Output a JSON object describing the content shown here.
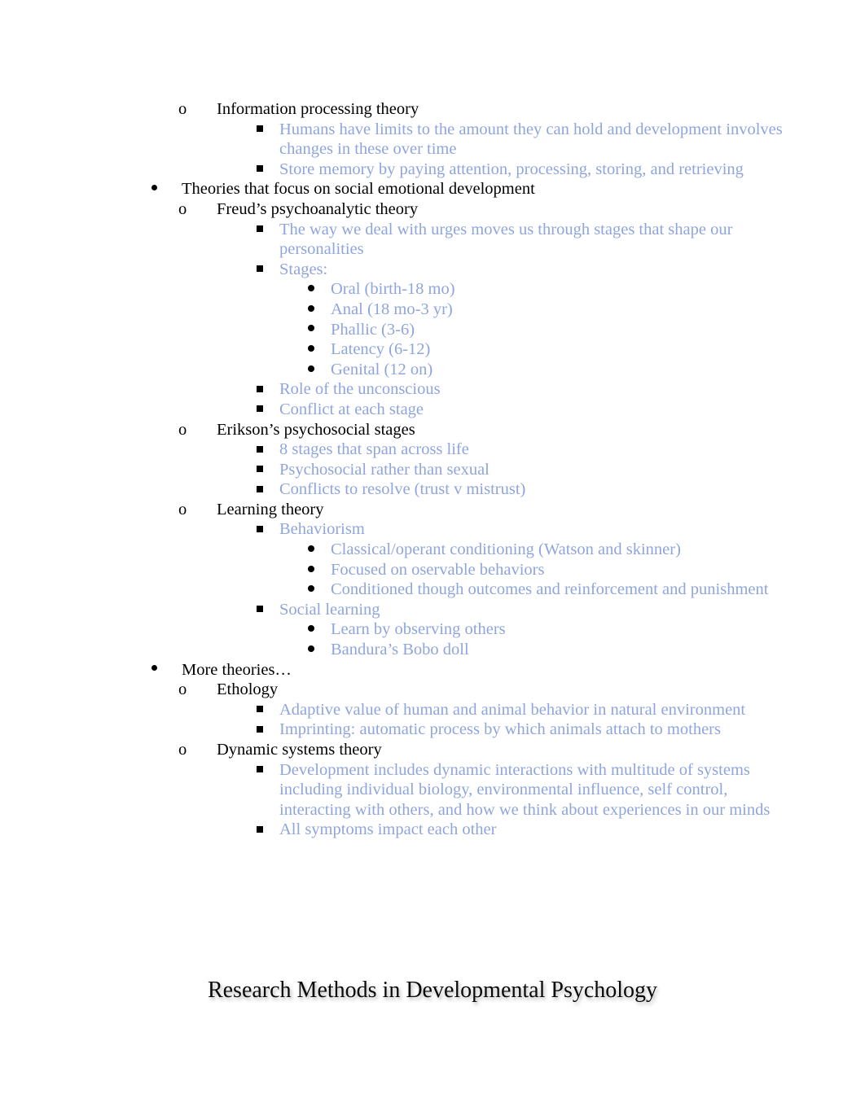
{
  "document": {
    "background_color": "#ffffff",
    "body_text_color_black": "#000000",
    "body_text_color_blue": "#8FA5DC",
    "heading_text_color": "#0a0a0a"
  },
  "outline": [
    {
      "level": 2,
      "marker": "o",
      "text": "Information processing theory"
    },
    {
      "level": 3,
      "marker": "square",
      "text": "Humans have limits to the amount they can hold and development involves changes in these over time"
    },
    {
      "level": 3,
      "marker": "square",
      "text": "Store memory by paying attention, processing, storing, and retrieving"
    },
    {
      "level": 1,
      "marker": "disc",
      "text": "Theories that focus on social emotional development"
    },
    {
      "level": 2,
      "marker": "o",
      "text": "Freud’s psychoanalytic theory"
    },
    {
      "level": 3,
      "marker": "square",
      "text": "The way we deal with urges moves us through stages that shape our personalities"
    },
    {
      "level": 3,
      "marker": "square",
      "text": "Stages:"
    },
    {
      "level": 4,
      "marker": "disc",
      "text": "Oral (birth-18 mo)"
    },
    {
      "level": 4,
      "marker": "disc",
      "text": "Anal (18 mo-3 yr)"
    },
    {
      "level": 4,
      "marker": "disc",
      "text": "Phallic (3-6)"
    },
    {
      "level": 4,
      "marker": "disc",
      "text": "Latency (6-12)"
    },
    {
      "level": 4,
      "marker": "disc",
      "text": "Genital (12 on)"
    },
    {
      "level": 3,
      "marker": "square",
      "text": "Role of the unconscious"
    },
    {
      "level": 3,
      "marker": "square",
      "text": "Conflict at each stage"
    },
    {
      "level": 2,
      "marker": "o",
      "text": "Erikson’s psychosocial stages"
    },
    {
      "level": 3,
      "marker": "square",
      "text": "8 stages that span across life"
    },
    {
      "level": 3,
      "marker": "square",
      "text": "Psychosocial rather than sexual"
    },
    {
      "level": 3,
      "marker": "square",
      "text": "Conflicts to resolve (trust v mistrust)"
    },
    {
      "level": 2,
      "marker": "o",
      "text": "Learning theory"
    },
    {
      "level": 3,
      "marker": "square",
      "text": "Behaviorism"
    },
    {
      "level": 4,
      "marker": "disc",
      "text": "Classical/operant conditioning (Watson and skinner)"
    },
    {
      "level": 4,
      "marker": "disc",
      "text": "Focused on oservable behaviors"
    },
    {
      "level": 4,
      "marker": "disc",
      "text": "Conditioned though outcomes and reinforcement and punishment"
    },
    {
      "level": 3,
      "marker": "square",
      "text": "Social learning"
    },
    {
      "level": 4,
      "marker": "disc",
      "text": "Learn by observing others"
    },
    {
      "level": 4,
      "marker": "disc",
      "text": "Bandura’s Bobo doll"
    },
    {
      "level": 1,
      "marker": "disc",
      "text": "More theories…"
    },
    {
      "level": 2,
      "marker": "o",
      "text": "Ethology"
    },
    {
      "level": 3,
      "marker": "square",
      "text": "Adaptive value of human and animal behavior in natural environment"
    },
    {
      "level": 3,
      "marker": "square",
      "text": "Imprinting: automatic process by which animals attach to mothers"
    },
    {
      "level": 2,
      "marker": "o",
      "text": "Dynamic systems theory"
    },
    {
      "level": 3,
      "marker": "square",
      "text": "Development includes dynamic interactions with multitude of systems including individual biology, environmental influence, self control, interacting with others, and how we think about experiences in our minds"
    },
    {
      "level": 3,
      "marker": "square",
      "text": "All symptoms impact each other"
    }
  ],
  "section_heading": {
    "text": "Research Methods in Developmental Psychology"
  }
}
